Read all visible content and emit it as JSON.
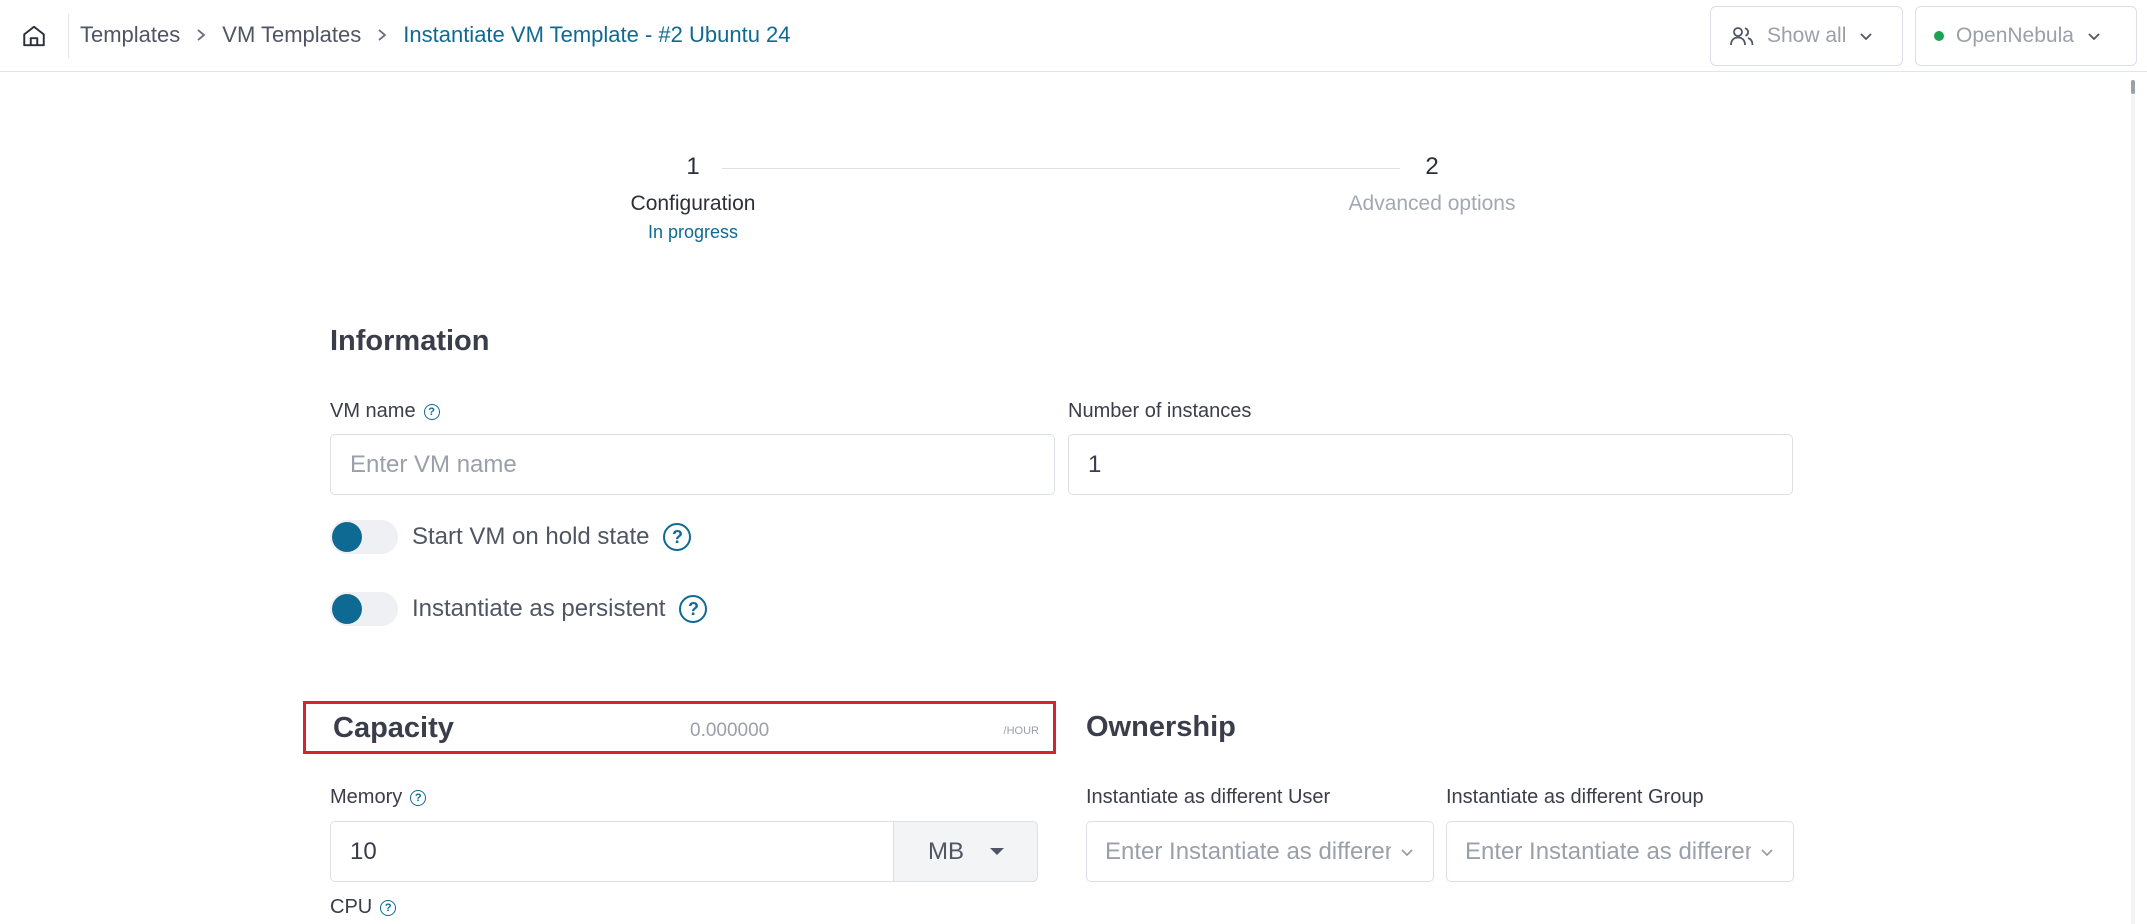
{
  "breadcrumb": {
    "items": [
      "Templates",
      "VM Templates",
      "Instantiate VM Template - #2 Ubuntu 24"
    ]
  },
  "header": {
    "show_all_label": "Show all",
    "zone_label": "OpenNebula",
    "zone_status_color": "#1aa350"
  },
  "stepper": {
    "steps": [
      {
        "number": "1",
        "label": "Configuration",
        "status": "In progress"
      },
      {
        "number": "2",
        "label": "Advanced options"
      }
    ]
  },
  "information": {
    "title": "Information",
    "vm_name_label": "VM name",
    "vm_name_placeholder": "Enter VM name",
    "vm_name_value": "",
    "instances_label": "Number of instances",
    "instances_value": "1",
    "hold_label": "Start VM on hold state",
    "persistent_label": "Instantiate as persistent"
  },
  "capacity": {
    "title": "Capacity",
    "cost": "0.000000",
    "cost_unit": "/HOUR",
    "memory_label": "Memory",
    "memory_value": "10",
    "memory_unit": "MB",
    "cpu_label": "CPU"
  },
  "ownership": {
    "title": "Ownership",
    "user_label": "Instantiate as different User",
    "user_placeholder": "Enter Instantiate as different User",
    "group_label": "Instantiate as different Group",
    "group_placeholder": "Enter Instantiate as different Group"
  },
  "colors": {
    "accent": "#0f6a93",
    "highlight_border": "#d7232c"
  }
}
